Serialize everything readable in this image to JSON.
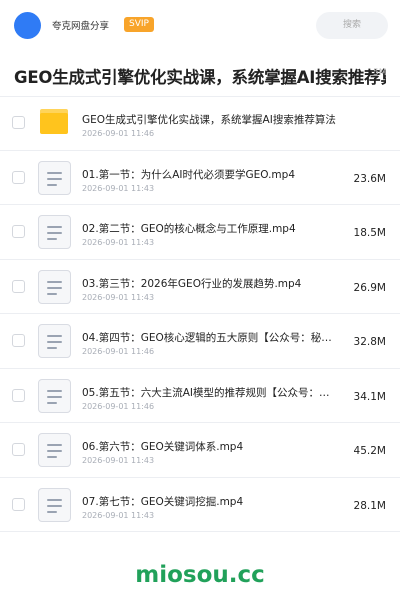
{
  "header": {
    "app_name": "夸克网盘分享",
    "badge": "SVIP",
    "search_placeholder": "搜索"
  },
  "page": {
    "title": "GEO生成式引擎优化实战课，系统掌握AI搜索推荐算法",
    "title_size": "5M"
  },
  "files": [
    {
      "type": "folder",
      "name": "GEO生成式引擎优化实战课，系统掌握AI搜索推荐算法",
      "date": "2026-09-01 11:46",
      "size": ""
    },
    {
      "type": "video",
      "name": "01.第一节：为什么AI时代必须要学GEO.mp4",
      "date": "2026-09-01 11:43",
      "size": "23.6M"
    },
    {
      "type": "video",
      "name": "02.第二节：GEO的核心概念与工作原理.mp4",
      "date": "2026-09-01 11:43",
      "size": "18.5M"
    },
    {
      "type": "video",
      "name": "03.第三节：2026年GEO行业的发展趋势.mp4",
      "date": "2026-09-01 11:43",
      "size": "26.9M"
    },
    {
      "type": "video",
      "name": "04.第四节：GEO核心逻辑的五大原则【公众号：秘…",
      "date": "2026-09-01 11:46",
      "size": "32.8M"
    },
    {
      "type": "video",
      "name": "05.第五节：六大主流AI模型的推荐规则【公众号：…",
      "date": "2026-09-01 11:46",
      "size": "34.1M"
    },
    {
      "type": "video",
      "name": "06.第六节：GEO关键词体系.mp4",
      "date": "2026-09-01 11:43",
      "size": "45.2M"
    },
    {
      "type": "video",
      "name": "07.第七节：GEO关键词挖掘.mp4",
      "date": "2026-09-01 11:43",
      "size": "28.1M"
    }
  ],
  "watermark": "miosou.cc",
  "colors": {
    "accent": "#2f7bf5",
    "badge": "#f8a42a",
    "folder": "#ffc41d",
    "watermark": "#21a15a"
  }
}
